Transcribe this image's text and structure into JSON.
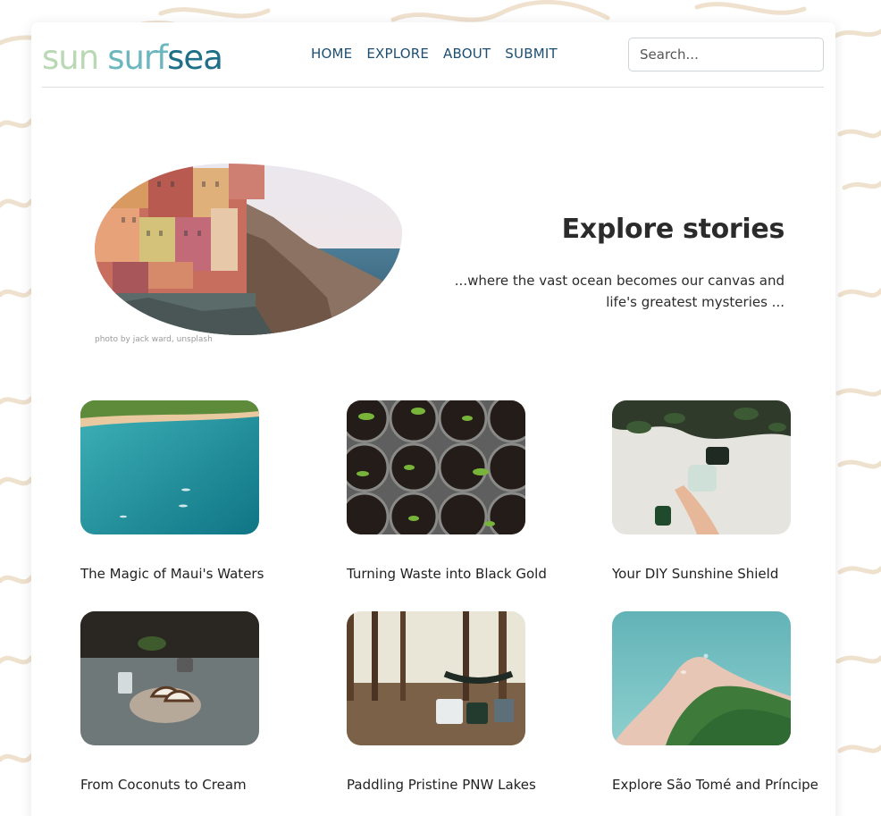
{
  "logo": {
    "word1": "sun",
    "word2": "surf",
    "word3": "sea"
  },
  "nav": {
    "items": [
      "HOME",
      "EXPLORE",
      "ABOUT",
      "SUBMIT"
    ]
  },
  "search": {
    "placeholder": "Search..."
  },
  "hero": {
    "title": "Explore stories",
    "subtitle": "...where the vast ocean becomes our canvas and life's greatest mysteries ...",
    "photo_credit": "photo by jack ward, unsplash"
  },
  "stories": [
    {
      "title": "The Magic of Maui's Waters"
    },
    {
      "title": "Turning Waste into Black Gold"
    },
    {
      "title": "Your DIY Sunshine Shield"
    },
    {
      "title": "From Coconuts to Cream"
    },
    {
      "title": "Paddling Pristine PNW Lakes"
    },
    {
      "title": "Explore São Tomé and Príncipe"
    }
  ],
  "colors": {
    "nav": "#1d4f73",
    "logo_light": "#b9d8b4",
    "logo_mid": "#6cb7bd",
    "logo_dark": "#1f6f89",
    "wave": "#ecdcc6"
  }
}
